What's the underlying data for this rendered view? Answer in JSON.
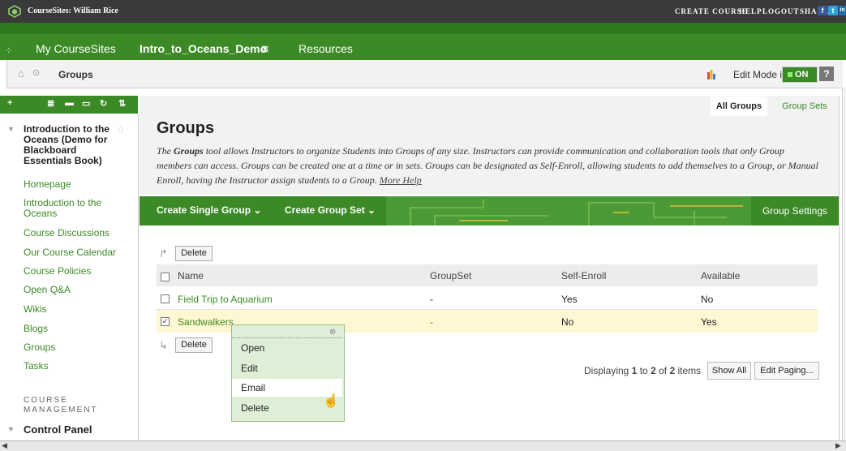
{
  "topbar": {
    "brand": "CourseSites: William Rice",
    "links": [
      "CREATE COURSE",
      "HELP",
      "LOGOUT",
      "SHARE |"
    ],
    "social": [
      "f",
      "t",
      "in"
    ]
  },
  "nav": {
    "tabs": [
      "My CourseSites",
      "Intro_to_Oceans_Demo",
      "Resources"
    ],
    "active_close": "⊠"
  },
  "breadcrumb": {
    "current": "Groups"
  },
  "editmode": {
    "label": "Edit Mode is:",
    "state": "ON",
    "help": "?"
  },
  "sidebar": {
    "course_title": "Introduction to the Oceans (Demo for Blackboard Essentials Book)",
    "items": [
      "Homepage",
      "Introduction to the Oceans",
      "Course Discussions",
      "Our Course Calendar",
      "Course Policies",
      "Open Q&A",
      "Wikis",
      "Blogs",
      "Groups",
      "Tasks"
    ],
    "management_label": "COURSE MANAGEMENT",
    "control_panel": "Control Panel"
  },
  "page": {
    "tabs": [
      "All Groups",
      "Group Sets"
    ],
    "title": "Groups",
    "desc_pre": "The ",
    "desc_bold": "Groups",
    "desc_post": " tool allows Instructors to organize Students into Groups of any size. Instructors can provide communication and collaboration tools that only Group members can access. Groups can be created one at a time or in sets. Groups can be designated as Self-Enroll, allowing students to add themselves to a Group, or Manual Enroll, having the Instructor assign students to a Group. ",
    "more_help": "More Help"
  },
  "actions": {
    "create_single": "Create Single Group ⌄",
    "create_set": "Create Group Set ⌄",
    "settings": "Group Settings"
  },
  "table": {
    "delete_label": "Delete",
    "columns": [
      "Name",
      "GroupSet",
      "Self-Enroll",
      "Available"
    ],
    "rows": [
      {
        "name": "Field Trip to Aquarium",
        "groupset": "-",
        "self_enroll": "Yes",
        "available": "No",
        "checked": false
      },
      {
        "name": "Sandwalkers",
        "groupset": "-",
        "self_enroll": "No",
        "available": "Yes",
        "checked": true
      }
    ]
  },
  "paging": {
    "pre": "Displaying ",
    "from": "1",
    "mid1": " to ",
    "to": "2",
    "mid2": " of ",
    "total": "2",
    "post": " items",
    "show_all": "Show All",
    "edit_paging": "Edit Paging..."
  },
  "context_menu": {
    "items": [
      "Open",
      "Edit",
      "Email",
      "Delete"
    ]
  },
  "colors": {
    "accent": "#3b8a26",
    "topbar": "#3a3a3a",
    "highlight_row": "#fff7d1"
  }
}
